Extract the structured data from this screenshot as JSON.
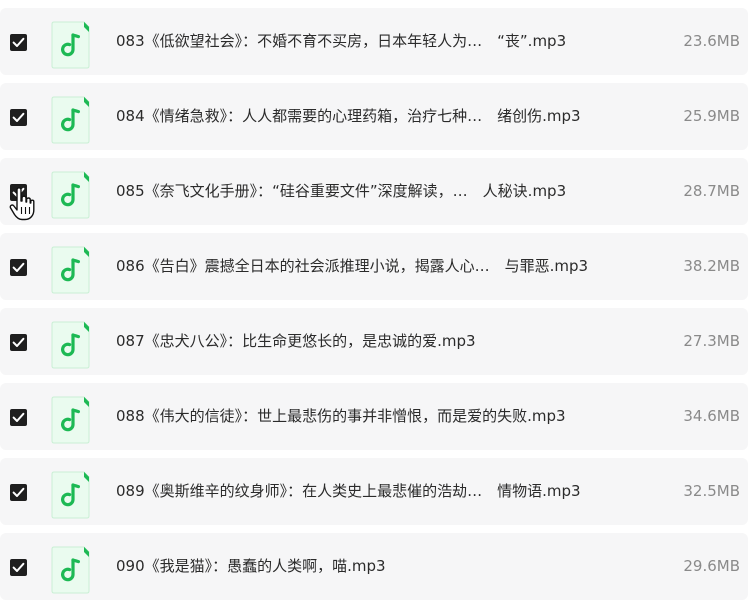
{
  "files": [
    {
      "name": "083《低欲望社会》：不婚不育不买房，日本年轻人为…　“丧”.mp3",
      "size": "23.6MB",
      "checked": true
    },
    {
      "name": "084《情绪急救》：人人都需要的心理药箱，治疗七种…　绪创伤.mp3",
      "size": "25.9MB",
      "checked": true
    },
    {
      "name": "085《奈飞文化手册》：“硅谷重要文件”深度解读，…　人秘诀.mp3",
      "size": "28.7MB",
      "checked": true
    },
    {
      "name": "086《告白》震撼全日本的社会派推理小说，揭露人心…　与罪恶.mp3",
      "size": "38.2MB",
      "checked": true
    },
    {
      "name": "087《忠犬八公》：比生命更悠长的，是忠诚的爱.mp3",
      "size": "27.3MB",
      "checked": true
    },
    {
      "name": "088《伟大的信徒》：世上最悲伤的事并非憎恨，而是爱的失败.mp3",
      "size": "34.6MB",
      "checked": true
    },
    {
      "name": "089《奥斯维辛的纹身师》：在人类史上最悲催的浩劫…　情物语.mp3",
      "size": "32.5MB",
      "checked": true
    },
    {
      "name": "090《我是猫》：愚蠢的人类啊，喵.mp3",
      "size": "29.6MB",
      "checked": true
    }
  ],
  "icons": {
    "file_type": "music-note-icon",
    "checkbox": "check-icon",
    "cursor": "hand-pointer-icon"
  },
  "colors": {
    "row_background": "#f6f6f7",
    "icon_green": "#1db954",
    "icon_bg": "#eafbef",
    "checkbox_fill": "#1f1f1f"
  }
}
